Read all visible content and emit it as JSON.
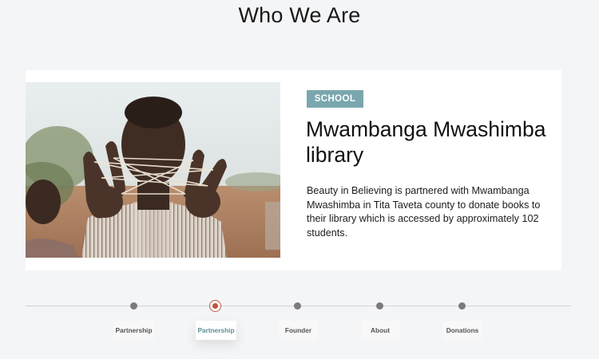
{
  "page": {
    "title": "Who We Are"
  },
  "card": {
    "badge": "SCHOOL",
    "title": "Mwambanga Mwashimba library",
    "description": "Beauty in Believing is partnered with Mwambanga Mwashimba in Tita Taveta county to donate books to their library which is accessed by approximately 102 students.",
    "image_subject": "child-playing-string-game-photo"
  },
  "timeline": {
    "active_index": 1,
    "items": [
      {
        "label": "Partnership"
      },
      {
        "label": "Partnership"
      },
      {
        "label": "Founder"
      },
      {
        "label": "About"
      },
      {
        "label": "Donations"
      }
    ]
  },
  "colors": {
    "background": "#f4f5f7",
    "badge": "#7aa7ae",
    "active_dot": "#c0533e",
    "active_tab_text": "#5f8f98",
    "dot": "#7b7b7b"
  }
}
